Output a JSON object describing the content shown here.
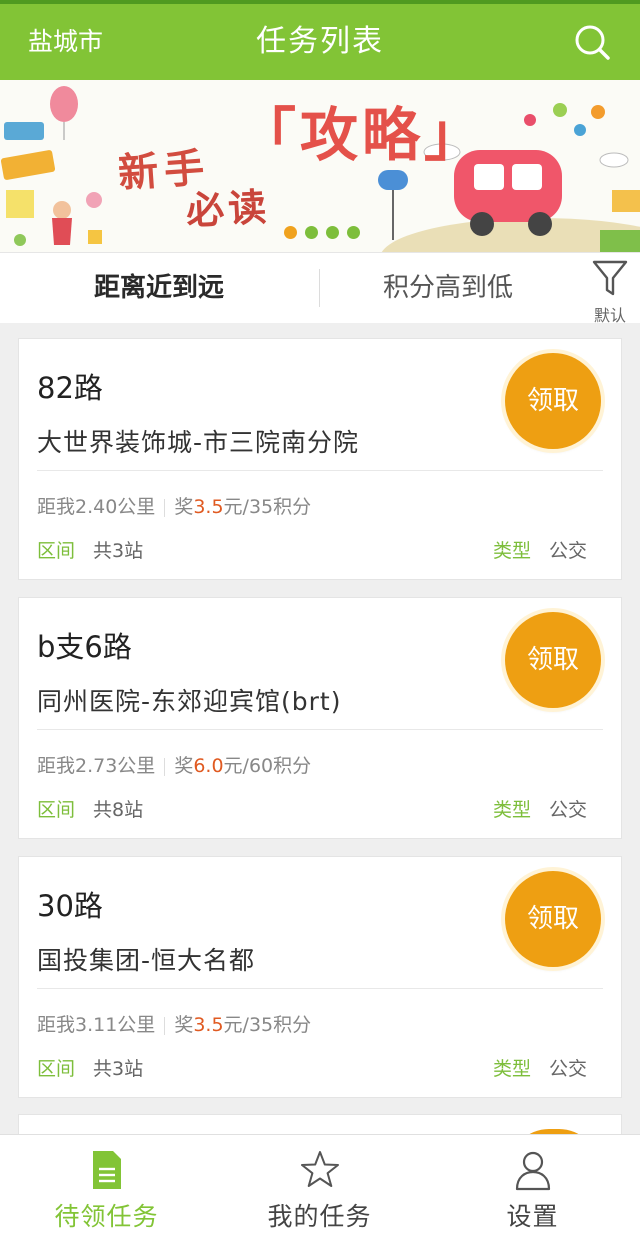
{
  "header": {
    "city": "盐城市",
    "title": "任务列表",
    "search_icon": "search-icon"
  },
  "banner": {
    "text_new": "新手",
    "text_guide": "「攻略」",
    "text_read": "必读",
    "dots_total": 4,
    "dots_active_index": 0
  },
  "sort": {
    "option1": "距离近到远",
    "option2": "积分高到低",
    "filter_label": "默认"
  },
  "tasks": [
    {
      "route": "82路",
      "stops": "大世界装饰城-市三院南分院",
      "distance": "距我2.40公里",
      "reward_prefix": "奖",
      "reward_amount": "3.5",
      "reward_suffix": "元/35积分",
      "section": "区间",
      "station_count": "共3站",
      "type_label": "类型",
      "type_value": "公交",
      "claim": "领取"
    },
    {
      "route": "b支6路",
      "stops": "同州医院-东郊迎宾馆(brt)",
      "distance": "距我2.73公里",
      "reward_prefix": "奖",
      "reward_amount": "6.0",
      "reward_suffix": "元/60积分",
      "section": "区间",
      "station_count": "共8站",
      "type_label": "类型",
      "type_value": "公交",
      "claim": "领取"
    },
    {
      "route": "30路",
      "stops": "国投集团-恒大名都",
      "distance": "距我3.11公里",
      "reward_prefix": "奖",
      "reward_amount": "3.5",
      "reward_suffix": "元/35积分",
      "section": "区间",
      "station_count": "共3站",
      "type_label": "类型",
      "type_value": "公交",
      "claim": "领取"
    }
  ],
  "tabs": [
    {
      "label": "待领任务",
      "icon": "document-icon",
      "active": true
    },
    {
      "label": "我的任务",
      "icon": "star-icon",
      "active": false
    },
    {
      "label": "设置",
      "icon": "user-icon",
      "active": false
    }
  ],
  "colors": {
    "brand_green": "#82c436",
    "claim_orange": "#ee9f12",
    "reward_red": "#e05a21"
  }
}
